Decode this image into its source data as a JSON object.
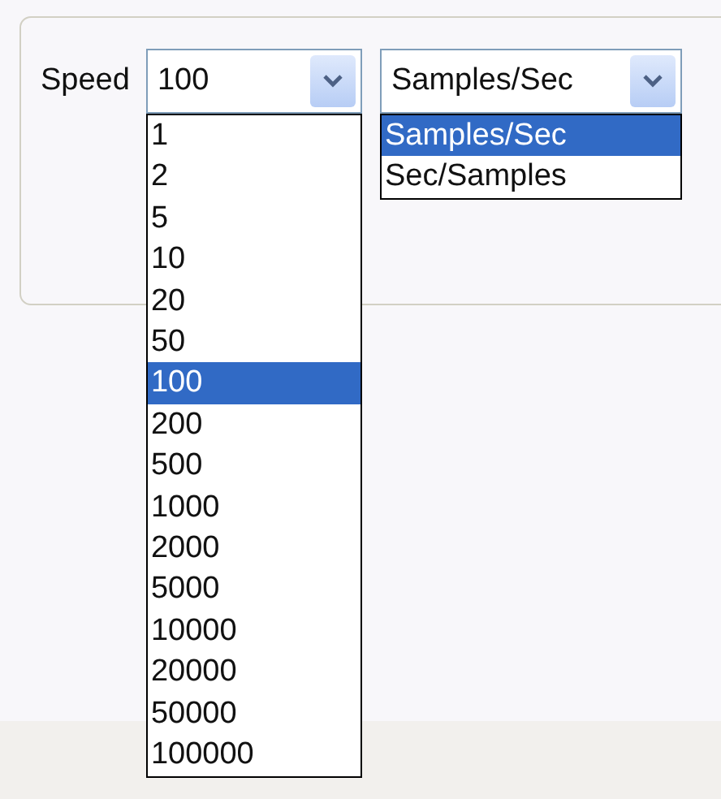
{
  "speed": {
    "label": "Speed",
    "value": "100",
    "expanded": true,
    "options": [
      {
        "label": "1",
        "selected": false
      },
      {
        "label": "2",
        "selected": false
      },
      {
        "label": "5",
        "selected": false
      },
      {
        "label": "10",
        "selected": false
      },
      {
        "label": "20",
        "selected": false
      },
      {
        "label": "50",
        "selected": false
      },
      {
        "label": "100",
        "selected": true
      },
      {
        "label": "200",
        "selected": false
      },
      {
        "label": "500",
        "selected": false
      },
      {
        "label": "1000",
        "selected": false
      },
      {
        "label": "2000",
        "selected": false
      },
      {
        "label": "5000",
        "selected": false
      },
      {
        "label": "10000",
        "selected": false
      },
      {
        "label": "20000",
        "selected": false
      },
      {
        "label": "50000",
        "selected": false
      },
      {
        "label": "100000",
        "selected": false
      }
    ]
  },
  "mode": {
    "value": "Samples/Sec",
    "expanded": true,
    "options": [
      {
        "label": "Samples/Sec",
        "selected": true
      },
      {
        "label": "Sec/Samples",
        "selected": false
      }
    ]
  }
}
